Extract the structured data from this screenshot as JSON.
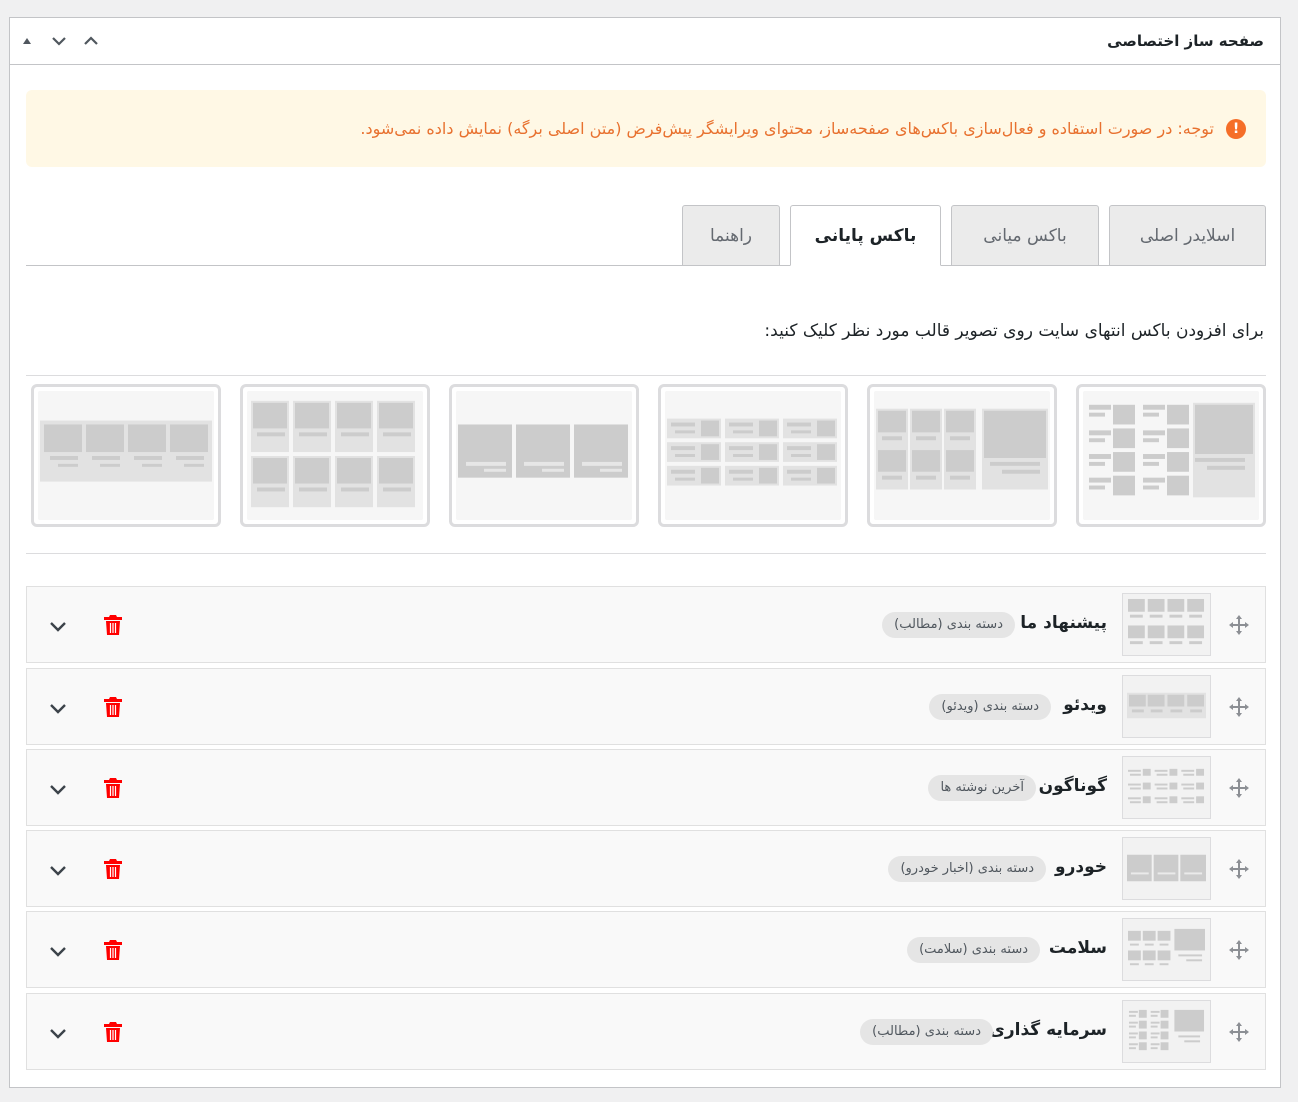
{
  "header": {
    "title": "صفحه ساز اختصاصی",
    "controls": [
      "arrow-up-small-icon",
      "chevron-down-icon",
      "chevron-up-icon"
    ]
  },
  "notice": {
    "icon": "exclamation-icon",
    "text": "توجه: در صورت استفاده و فعال‌سازی باکس‌های صفحه‌ساز، محتوای ویرایشگر پیش‌فرض (متن اصلی برگه) نمایش داده نمی‌شود.",
    "color": "#e8712f"
  },
  "tabs": [
    {
      "label": "اسلایدر اصلی",
      "active": false
    },
    {
      "label": "باکس میانی",
      "active": false
    },
    {
      "label": "باکس پایانی",
      "active": true
    },
    {
      "label": "راهنما",
      "active": false
    }
  ],
  "instruction": "برای افزودن باکس انتهای سایت روی تصویر قالب مورد نظر کلیک کنید:",
  "templates": [
    "layout-featured-list",
    "layout-grid-with-big",
    "layout-list-grid",
    "layout-three-cards",
    "layout-eight-grid",
    "layout-four-strip"
  ],
  "rows": [
    {
      "title": "پیشنهاد ما",
      "badge": "دسته بندی (مطالب)",
      "thumb": "layout-eight-grid"
    },
    {
      "title": "ویدئو",
      "badge": "دسته بندی (ویدئو)",
      "thumb": "layout-four-strip"
    },
    {
      "title": "گوناگون",
      "badge": "آخرین نوشته ها",
      "thumb": "layout-list-grid"
    },
    {
      "title": "خودرو",
      "badge": "دسته بندی (اخبار خودرو)",
      "thumb": "layout-three-cards"
    },
    {
      "title": "سلامت",
      "badge": "دسته بندی (سلامت)",
      "thumb": "layout-grid-with-big"
    },
    {
      "title": "سرمایه گذاری",
      "badge": "دسته بندی (مطالب)",
      "thumb": "layout-featured-list"
    }
  ],
  "row_icons": {
    "move": "move-arrows-icon",
    "delete": "trash-icon",
    "expand": "chevron-down-icon"
  },
  "colors": {
    "accent_delete": "#ff0000",
    "notice_bg": "#fff8e5",
    "tab_inactive_bg": "#ebebeb"
  }
}
